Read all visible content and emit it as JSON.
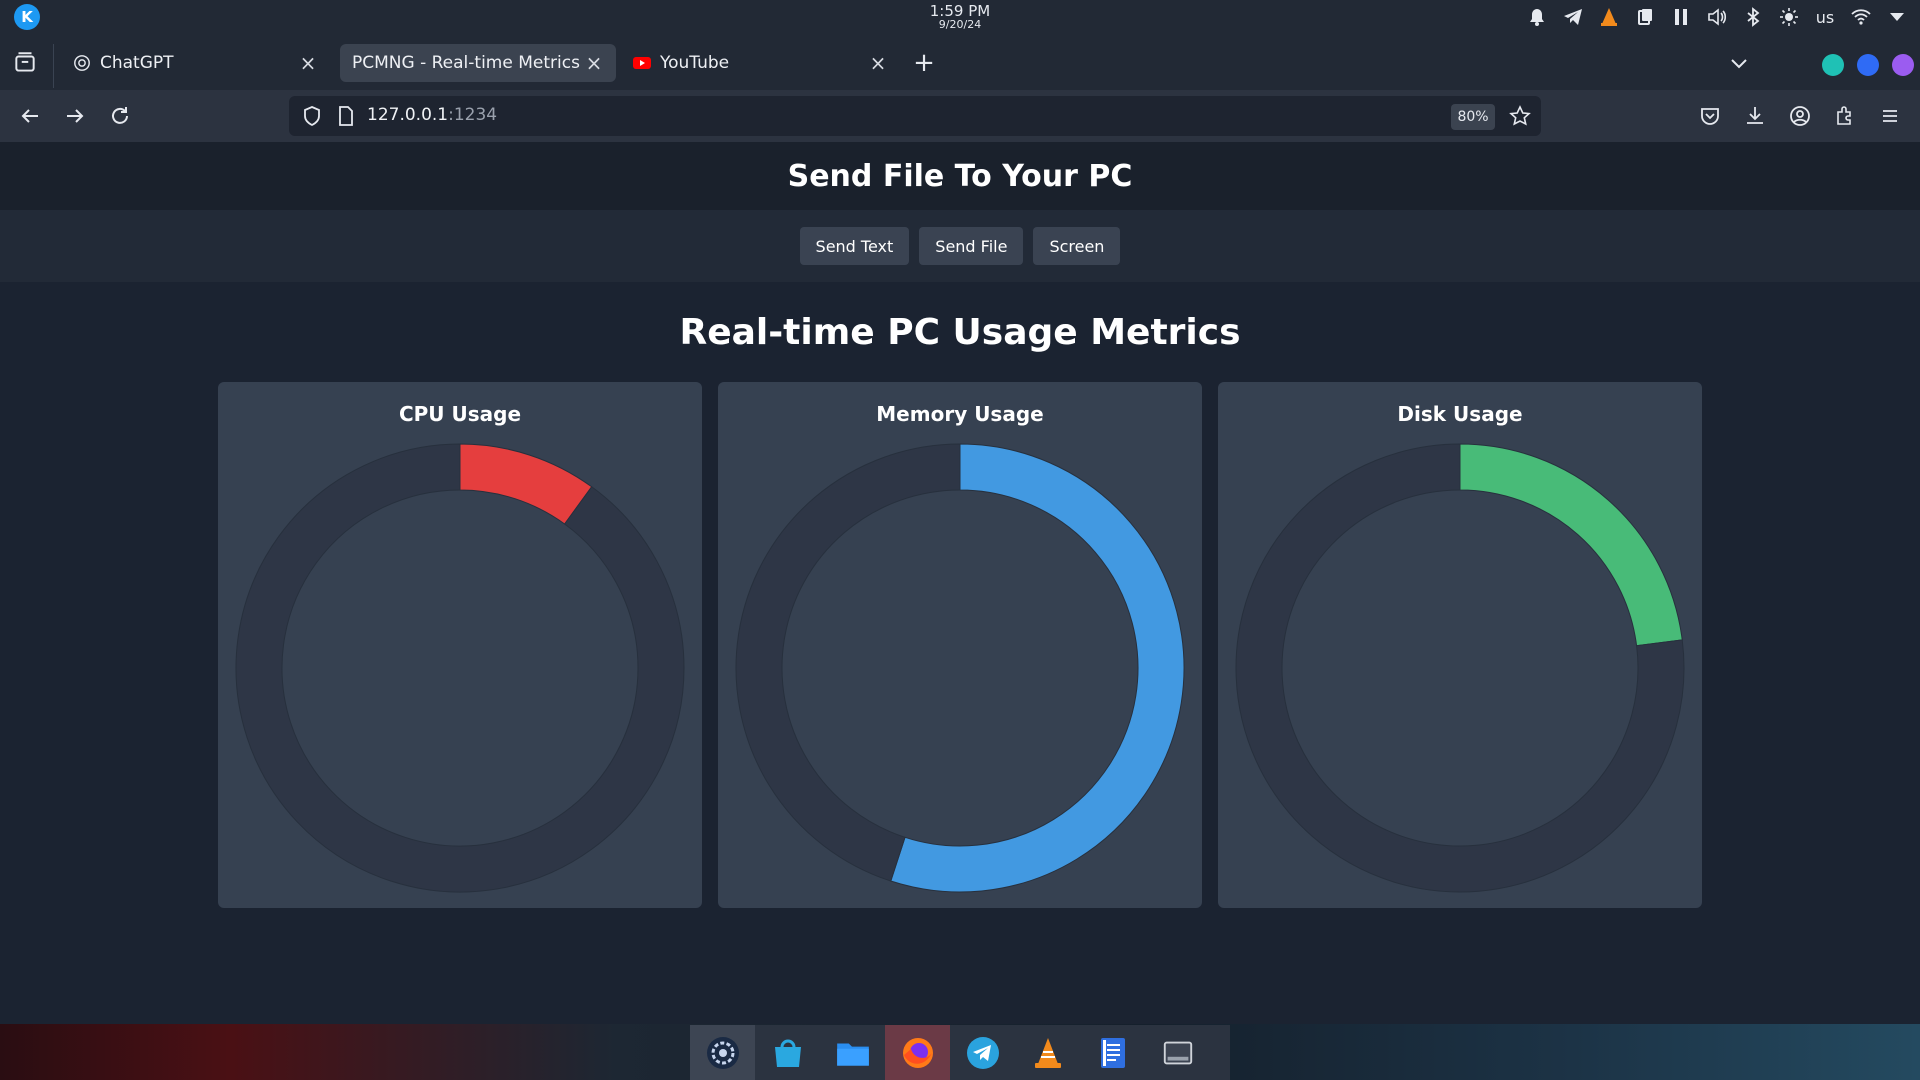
{
  "panel": {
    "time": "1:59 PM",
    "date": "9/20/24",
    "keyboard_layout": "us",
    "tray_icons": [
      "bell-icon",
      "telegram-icon",
      "vlc-icon",
      "clipboard-icon",
      "pause-icon",
      "volume-icon",
      "bluetooth-icon",
      "brightness-icon",
      "wifi-icon",
      "chevron-down-icon"
    ]
  },
  "tabs": [
    {
      "title": "ChatGPT",
      "icon": "chatgpt-icon",
      "active": false
    },
    {
      "title": "PCMNG - Real-time Metrics",
      "icon": "none",
      "active": true
    },
    {
      "title": "YouTube",
      "icon": "youtube-icon",
      "active": false
    }
  ],
  "navbar": {
    "url_host": "127.0.0.1",
    "url_port": ":1234",
    "zoom": "80%"
  },
  "page": {
    "header_title": "Send File To Your PC",
    "buttons": [
      "Send Text",
      "Send File",
      "Screen"
    ],
    "metrics_title": "Real-time PC Usage Metrics"
  },
  "chart_data": [
    {
      "type": "doughnut",
      "title": "CPU Usage",
      "values": [
        10,
        90
      ],
      "colors": [
        "#e53e3e",
        "#2e3646"
      ]
    },
    {
      "type": "doughnut",
      "title": "Memory Usage",
      "values": [
        55,
        45
      ],
      "colors": [
        "#4299e1",
        "#2e3646"
      ]
    },
    {
      "type": "doughnut",
      "title": "Disk Usage",
      "values": [
        23,
        77
      ],
      "colors": [
        "#48bb78",
        "#2e3646"
      ]
    }
  ],
  "dock": {
    "apps": [
      "system-settings-icon",
      "discover-store-icon",
      "files-folder-icon",
      "firefox-icon",
      "telegram-icon",
      "vlc-icon",
      "text-editor-icon",
      "terminal-icon"
    ]
  }
}
